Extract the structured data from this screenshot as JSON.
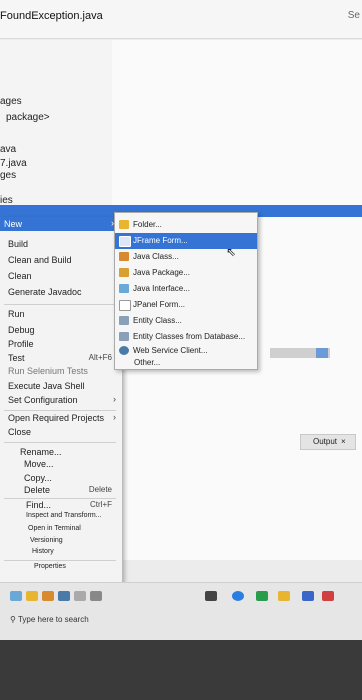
{
  "window": {
    "title": "FoundException.java",
    "corner_label": "Se"
  },
  "tree": {
    "lines": [
      "ages",
      "package>",
      "ava",
      "7.java",
      "ges",
      "ies"
    ]
  },
  "context_menu": {
    "new_label": "New",
    "items": [
      {
        "label": "Build",
        "shortcut": ""
      },
      {
        "label": "Clean and Build",
        "shortcut": ""
      },
      {
        "label": "Clean",
        "shortcut": ""
      },
      {
        "label": "Generate Javadoc",
        "shortcut": ""
      },
      {
        "label": "Run",
        "shortcut": ""
      },
      {
        "label": "Debug",
        "shortcut": ""
      },
      {
        "label": "Profile",
        "shortcut": ""
      },
      {
        "label": "Test",
        "shortcut": "Alt+F6"
      },
      {
        "label": "Run Selenium Tests",
        "shortcut": ""
      },
      {
        "label": "Execute Java Shell",
        "shortcut": ""
      },
      {
        "label": "Set Configuration",
        "shortcut": ""
      },
      {
        "label": "Open Required Projects",
        "shortcut": ""
      },
      {
        "label": "Close",
        "shortcut": ""
      },
      {
        "label": "Rename...",
        "shortcut": ""
      },
      {
        "label": "Move...",
        "shortcut": ""
      },
      {
        "label": "Copy...",
        "shortcut": ""
      },
      {
        "label": "Delete",
        "shortcut": "Delete"
      },
      {
        "label": "Find...",
        "shortcut": "Ctrl+F"
      },
      {
        "label": "Inspect and Transform...",
        "shortcut": ""
      },
      {
        "label": "Open in Terminal",
        "shortcut": ""
      },
      {
        "label": "Versioning",
        "shortcut": ""
      },
      {
        "label": "History",
        "shortcut": ""
      },
      {
        "label": "Properties",
        "shortcut": ""
      }
    ]
  },
  "submenu": {
    "items": [
      {
        "label": "Folder...",
        "icon": "folder-icon",
        "color": "#e8b530"
      },
      {
        "label": "JFrame Form...",
        "icon": "jframe-icon",
        "color": "#5a8fd8"
      },
      {
        "label": "Java Class...",
        "icon": "java-class-icon",
        "color": "#d88a30"
      },
      {
        "label": "Java Package...",
        "icon": "package-icon",
        "color": "#d8a030"
      },
      {
        "label": "Java Interface...",
        "icon": "interface-icon",
        "color": "#6aa8d8"
      },
      {
        "label": "JPanel Form...",
        "icon": "jpanel-icon",
        "color": "#ffffff"
      },
      {
        "label": "Entity Class...",
        "icon": "entity-icon",
        "color": "#8aa0b8"
      },
      {
        "label": "Entity Classes from Database...",
        "icon": "entity-db-icon",
        "color": "#8aa0b8"
      },
      {
        "label": "Web Service Client...",
        "icon": "web-service-icon",
        "color": "#4a7aa8"
      },
      {
        "label": "Other...",
        "icon": "",
        "color": ""
      }
    ]
  },
  "output_tab": {
    "label": "Output"
  },
  "taskbar": {
    "search_placeholder": "Type here to search"
  },
  "colors": {
    "selection": "#3574d4"
  }
}
